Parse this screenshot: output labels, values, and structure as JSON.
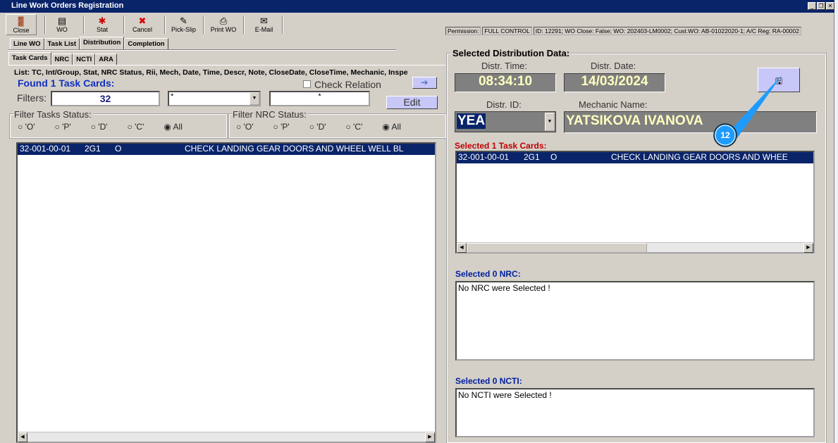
{
  "window": {
    "title": "Line Work Orders Registration"
  },
  "toolbar": [
    {
      "label": "Close",
      "icon": "🚪"
    },
    {
      "label": "WO",
      "icon": "▤"
    },
    {
      "label": "Stat",
      "icon": "✱"
    },
    {
      "label": "Cancel",
      "icon": "✖"
    },
    {
      "label": "Pick-Slip",
      "icon": "✎"
    },
    {
      "label": "Print WO",
      "icon": "⎙"
    },
    {
      "label": "E-Mail",
      "icon": "✉"
    }
  ],
  "status": {
    "permission_label": "Permission:",
    "permission_value": "FULL CONTROL",
    "info": "ID: 12291; WO Close: False; WO: 202403-LM0002; Cust.WO: AB-01022020-1; A/C Reg: RA-00002"
  },
  "main_tabs": [
    "Line WO",
    "Task List",
    "Distribution",
    "Completion"
  ],
  "sub_tabs": [
    "Task Cards",
    "NRC",
    "NCTI",
    "ARA"
  ],
  "left": {
    "list_caption": "List: TC, Int/Group, Stat, NRC Status, Rii, Mech, Date, Time, Descr, Note, CloseDate, CloseTime, Mechanic, Inspe",
    "found": "Found 1 Task Cards:",
    "check_relation": "Check Relation",
    "filters_label": "Filters:",
    "filter1": "32",
    "filter2": "*",
    "filter3": "*",
    "edit": "Edit",
    "task_status_label": "Filter Tasks Status:",
    "nrc_status_label": "Filter NRC Status:",
    "status_options": [
      "'O'",
      "'P'",
      "'D'",
      "'C'",
      "All"
    ],
    "rows": [
      {
        "tc": "32-001-00-01",
        "group": "2G1",
        "stat": "O",
        "descr": "CHECK LANDING GEAR DOORS AND WHEEL WELL BL"
      }
    ]
  },
  "right": {
    "group_title": "Selected Distribution Data:",
    "time_label": "Distr. Time:",
    "time": "08:34:10",
    "date_label": "Distr. Date:",
    "date": "14/03/2024",
    "id_label": "Distr. ID:",
    "id": "YEA",
    "mech_label": "Mechanic Name:",
    "mech": "YATSIKOVA IVANOVA",
    "sel_tc": "Selected 1 Task Cards:",
    "tc_rows": [
      {
        "tc": "32-001-00-01",
        "group": "2G1",
        "stat": "O",
        "descr": "CHECK LANDING GEAR DOORS AND WHEE"
      }
    ],
    "sel_nrc": "Selected 0 NRC:",
    "nrc_empty": "No NRC were Selected !",
    "sel_ncti": "Selected 0 NCTI:",
    "ncti_empty": "No NCTI were Selected !"
  },
  "annotation": {
    "badge": "12"
  }
}
